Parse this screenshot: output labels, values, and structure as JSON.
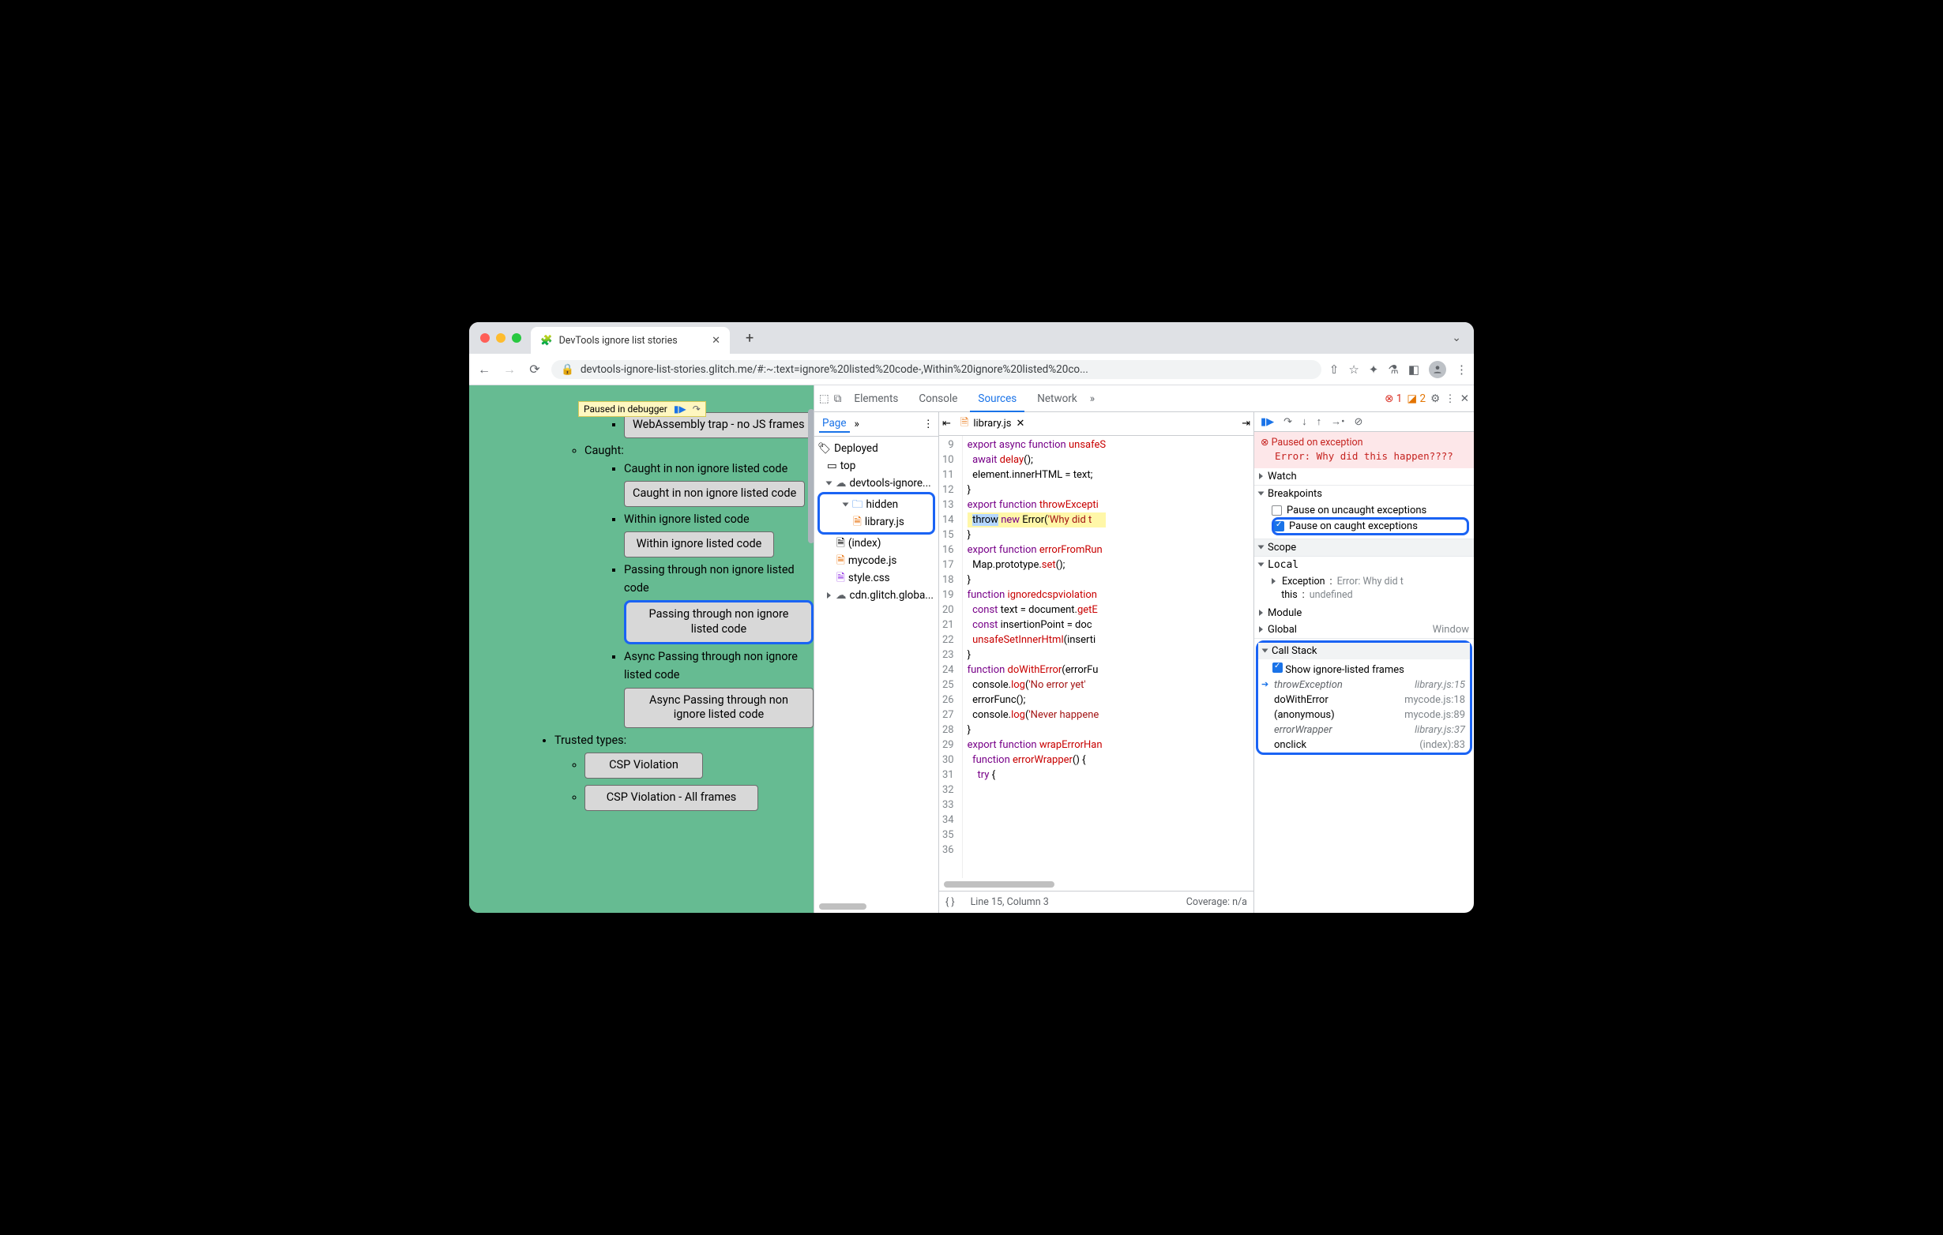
{
  "tab": {
    "title": "DevTools ignore list stories"
  },
  "url": "devtools-ignore-list-stories.glitch.me/#:~:text=ignore%20listed%20code-,Within%20ignore%20listed%20co...",
  "paused_banner": "Paused in debugger",
  "page": {
    "partial_btn": "WebAssembly trap - no JS frames",
    "caught": "Caught:",
    "i1": "Caught in non ignore listed code",
    "b1": "Caught in non ignore listed code",
    "i2": "Within ignore listed code",
    "b2": "Within ignore listed code",
    "i3": "Passing through non ignore listed code",
    "b3": "Passing through non ignore listed code",
    "i4": "Async Passing through non ignore listed code",
    "b4": "Async Passing through non ignore listed code",
    "trusted": "Trusted types:",
    "b5": "CSP Violation",
    "b6": "CSP Violation - All frames"
  },
  "devtools": {
    "tabs": {
      "elements": "Elements",
      "console": "Console",
      "sources": "Sources",
      "network": "Network"
    },
    "errors": "1",
    "warnings": "2",
    "nav": {
      "page": "Page",
      "deployed": "Deployed",
      "top": "top",
      "domain": "devtools-ignore...",
      "hidden": "hidden",
      "library": "library.js",
      "index": "(index)",
      "mycode": "mycode.js",
      "style": "style.css",
      "cdn": "cdn.glitch.globa..."
    },
    "file": {
      "name": "library.js"
    },
    "code_lines": [
      {
        "n": 9,
        "t": "export async function unsafeS"
      },
      {
        "n": 10,
        "t": "  await delay();"
      },
      {
        "n": 11,
        "t": "  element.innerHTML = text;"
      },
      {
        "n": 12,
        "t": "}"
      },
      {
        "n": 13,
        "t": ""
      },
      {
        "n": 14,
        "t": "export function throwExcepti"
      },
      {
        "n": 15,
        "t": "  throw new Error('Why did t"
      },
      {
        "n": 16,
        "t": "}"
      },
      {
        "n": 17,
        "t": ""
      },
      {
        "n": 18,
        "t": "export function errorFromRun"
      },
      {
        "n": 19,
        "t": "  Map.prototype.set();"
      },
      {
        "n": 20,
        "t": "}"
      },
      {
        "n": 21,
        "t": ""
      },
      {
        "n": 22,
        "t": "function ignoredcspviolation"
      },
      {
        "n": 23,
        "t": "  const text = document.getE"
      },
      {
        "n": 24,
        "t": "  const insertionPoint = doc"
      },
      {
        "n": 25,
        "t": "  unsafeSetInnerHtml(inserti"
      },
      {
        "n": 26,
        "t": "}"
      },
      {
        "n": 27,
        "t": ""
      },
      {
        "n": 28,
        "t": "function doWithError(errorFu"
      },
      {
        "n": 29,
        "t": "  console.log('No error yet'"
      },
      {
        "n": 30,
        "t": "  errorFunc();"
      },
      {
        "n": 31,
        "t": "  console.log('Never happene"
      },
      {
        "n": 32,
        "t": "}"
      },
      {
        "n": 33,
        "t": ""
      },
      {
        "n": 34,
        "t": "export function wrapErrorHan"
      },
      {
        "n": 35,
        "t": "  function errorWrapper() {"
      },
      {
        "n": 36,
        "t": "    try {"
      }
    ],
    "footer": {
      "pos": "Line 15, Column 3",
      "cov": "Coverage: n/a"
    },
    "pause_msg": {
      "title": "Paused on exception",
      "detail": "Error: Why did this happen????"
    },
    "sections": {
      "watch": "Watch",
      "breakpoints": "Breakpoints",
      "scope": "Scope",
      "callstack": "Call Stack"
    },
    "bp": {
      "uncaught": "Pause on uncaught exceptions",
      "caught": "Pause on caught exceptions"
    },
    "scope": {
      "local": "Local",
      "exc": "Exception",
      "excv": "Error: Why did t",
      "this": "this",
      "thisv": "undefined",
      "module": "Module",
      "global": "Global",
      "globalv": "Window"
    },
    "cs": {
      "show": "Show ignore-listed frames",
      "f": [
        {
          "n": "throwException",
          "l": "library.js:15",
          "it": true,
          "cur": true
        },
        {
          "n": "doWithError",
          "l": "mycode.js:18"
        },
        {
          "n": "(anonymous)",
          "l": "mycode.js:89"
        },
        {
          "n": "errorWrapper",
          "l": "library.js:37",
          "it": true
        },
        {
          "n": "onclick",
          "l": "(index):83"
        }
      ]
    }
  }
}
